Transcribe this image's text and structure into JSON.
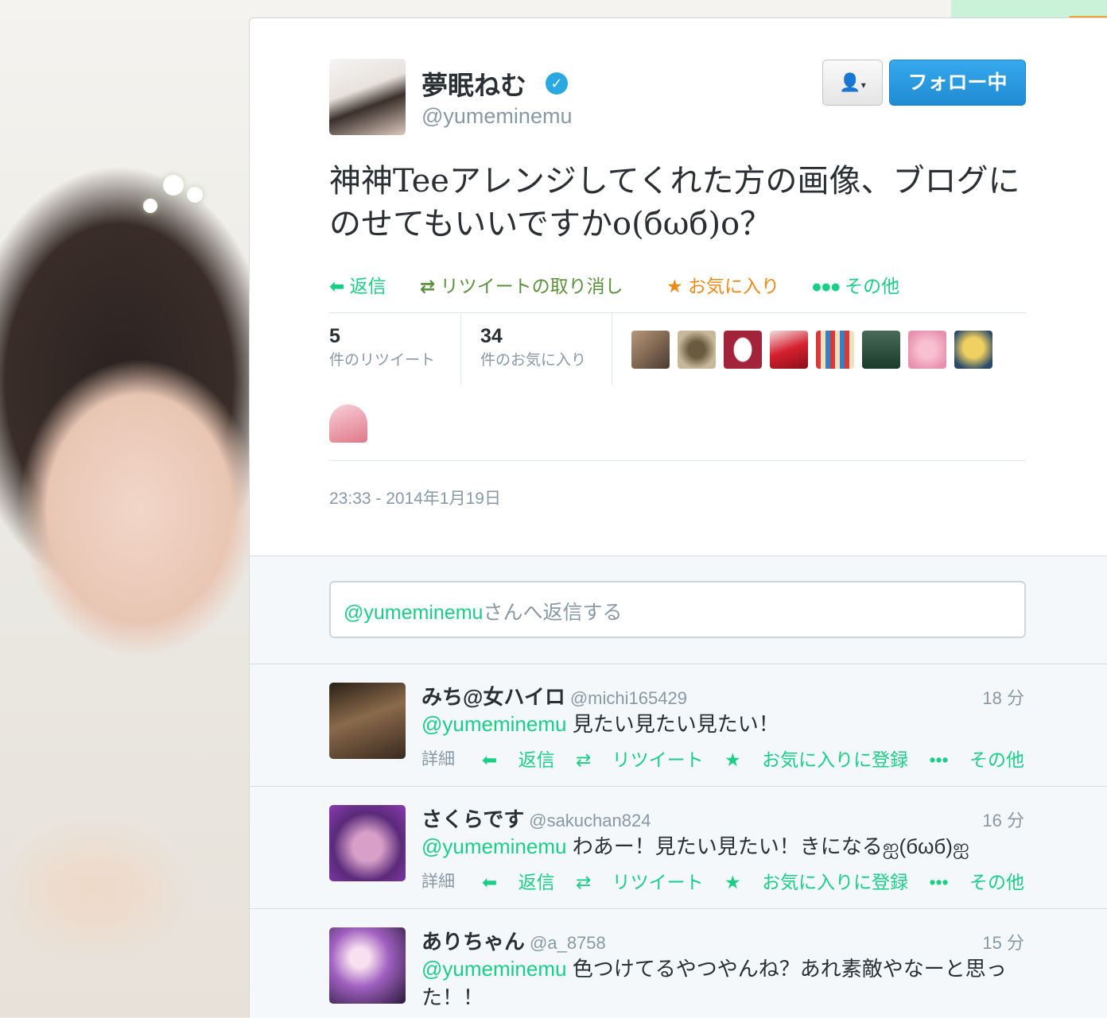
{
  "tweet": {
    "display_name": "夢眠ねむ",
    "screen_name": "@yumeminemu",
    "follow_button": "フォロー中",
    "text": "神神Teeアレンジしてくれた方の画像、ブログにのせてもいいですかo(бωб)o？",
    "actions": {
      "reply": "返信",
      "retweet": "リツイートの取り消し",
      "favorite": "お気に入り",
      "more": "その他"
    },
    "stats": {
      "retweet_count": "5",
      "retweet_label": "件のリツイート",
      "favorite_count": "34",
      "favorite_label": "件のお気に入り"
    },
    "timestamp": "23:33 - 2014年1月19日"
  },
  "reply_box": {
    "mention": "@yumeminemu",
    "placeholder": "さんへ返信する"
  },
  "replies": [
    {
      "name": "みち@女ハイロ",
      "handle": "@michi165429",
      "time": "18 分",
      "mention": "@yumeminemu",
      "text": "見たい見たい見たい！",
      "detail": "詳細",
      "reply": "返信",
      "retweet": "リツイート",
      "favorite": "お気に入りに登録",
      "more": "その他"
    },
    {
      "name": "さくらです",
      "handle": "@sakuchan824",
      "time": "16 分",
      "mention": "@yumeminemu",
      "text": "わあー！見たい見たい！きになるஐ(бωб)ஐ",
      "detail": "詳細",
      "reply": "返信",
      "retweet": "リツイート",
      "favorite": "お気に入りに登録",
      "more": "その他"
    },
    {
      "name": "ありちゃん",
      "handle": "@a_8758",
      "time": "15 分",
      "mention": "@yumeminemu",
      "text": "色つけてるやつやんね？あれ素敵やなーと思った！！"
    }
  ],
  "colors": {
    "accent_green": "#19cf86",
    "follow_blue": "#1f8bd3",
    "favorite_orange": "#ed8a19"
  }
}
